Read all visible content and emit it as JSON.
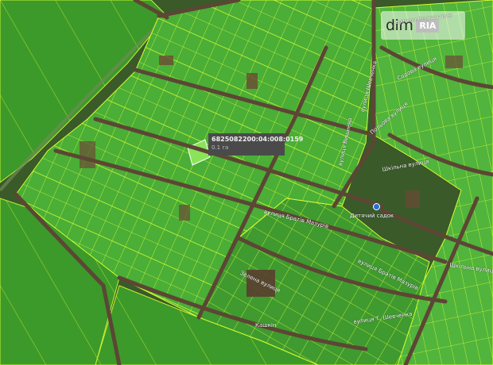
{
  "watermark": {
    "brand": "dim",
    "badge": "RIA"
  },
  "parcel_info": {
    "cadastral_number": "6825082200:04:008:0159",
    "area": "0.1 га"
  },
  "street_labels": [
    "вулиця Костянтина",
    "Садова вулиця",
    "вулиця Шевченка",
    "Польова вулиця",
    "вулиця Вишнева",
    "Шкільна вулиця",
    "вулиця Братів Мазурів",
    "вулиця Братів Мазурів",
    "Зелена вулиця",
    "Шкільна вулиця",
    "вулиця Т. Шевченка",
    "Кашкін"
  ],
  "poi": {
    "label": "Дитячий садок"
  },
  "colors": {
    "field": "#3f9a2e",
    "parcel_fill": "#4fb33a",
    "parcel_line": "#d7ff2e",
    "road": "#5c4634",
    "tooltip_bg": "#4a4a4a"
  }
}
